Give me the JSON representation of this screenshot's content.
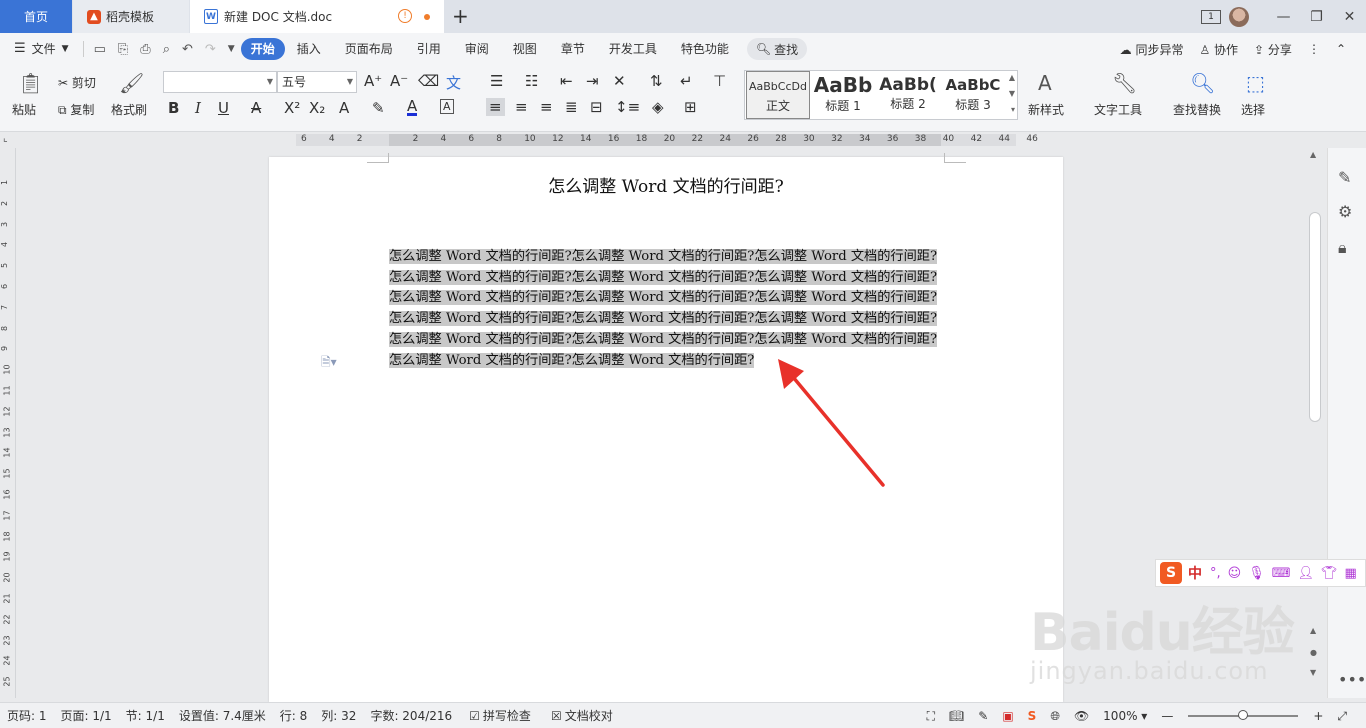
{
  "titlebar": {
    "tabs": [
      {
        "label": "首页"
      },
      {
        "label": "稻壳模板"
      },
      {
        "label": "新建 DOC 文档.doc"
      }
    ],
    "new_tab": "+",
    "window_badge": "1"
  },
  "menubar": {
    "file": "文件",
    "items": [
      "开始",
      "插入",
      "页面布局",
      "引用",
      "审阅",
      "视图",
      "章节",
      "开发工具",
      "特色功能"
    ],
    "active": "开始",
    "search": "查找",
    "right": [
      "同步异常",
      "协作",
      "分享"
    ]
  },
  "ribbon": {
    "paste": "粘贴",
    "cut": "剪切",
    "copy": "复制",
    "format_painter": "格式刷",
    "font_name": "",
    "font_size": "五号",
    "styles": [
      {
        "preview": "AaBbCcDd",
        "name": "正文"
      },
      {
        "preview": "AaBb",
        "name": "标题 1"
      },
      {
        "preview": "AaBb(",
        "name": "标题 2"
      },
      {
        "preview": "AaBbC",
        "name": "标题 3"
      }
    ],
    "new_style": "新样式",
    "text_tools": "文字工具",
    "find_replace": "查找替换",
    "select": "选择"
  },
  "ruler": {
    "h_ticks": [
      "6",
      "4",
      "2",
      "",
      "2",
      "4",
      "6",
      "8",
      "10",
      "12",
      "14",
      "16",
      "18",
      "20",
      "22",
      "24",
      "26",
      "28",
      "30",
      "32",
      "34",
      "36",
      "38",
      "40",
      "42",
      "44",
      "46"
    ],
    "v_ticks": [
      "1",
      "2",
      "3",
      "4",
      "5",
      "6",
      "7",
      "8",
      "9",
      "10",
      "11",
      "12",
      "13",
      "14",
      "15",
      "16",
      "17",
      "18",
      "19",
      "20",
      "21",
      "22",
      "23",
      "24",
      "25"
    ]
  },
  "document": {
    "title": "怎么调整 Word 文档的行间距?",
    "lines": [
      "怎么调整 Word 文档的行间距?怎么调整 Word 文档的行间距?怎么调整 Word 文档的行间距?",
      "怎么调整 Word 文档的行间距?怎么调整 Word 文档的行间距?怎么调整 Word 文档的行间距?",
      "怎么调整 Word 文档的行间距?怎么调整 Word 文档的行间距?怎么调整 Word 文档的行间距?",
      "怎么调整 Word 文档的行间距?怎么调整 Word 文档的行间距?怎么调整 Word 文档的行间距?",
      "怎么调整 Word 文档的行间距?怎么调整 Word 文档的行间距?怎么调整 Word 文档的行间距?",
      "怎么调整 Word 文档的行间距?怎么调整 Word 文档的行间距? "
    ]
  },
  "ime": {
    "lang": "中",
    "punct": "°,"
  },
  "watermark": {
    "main": "Baidu经验",
    "sub": "jingyan.baidu.com"
  },
  "statusbar": {
    "page_num": "页码: 1",
    "page": "页面: 1/1",
    "section": "节: 1/1",
    "setting": "设置值: 7.4厘米",
    "row": "行: 8",
    "col": "列: 32",
    "words": "字数: 204/216",
    "spell_check": "拼写检查",
    "doc_proof": "文档校对",
    "zoom": "100%",
    "zoom_fraction": 0.5
  },
  "colors": {
    "accent": "#3a74d6",
    "selection": "#c8c8c8",
    "arrow": "#e8312a",
    "ime_logo": "#f15a22"
  }
}
